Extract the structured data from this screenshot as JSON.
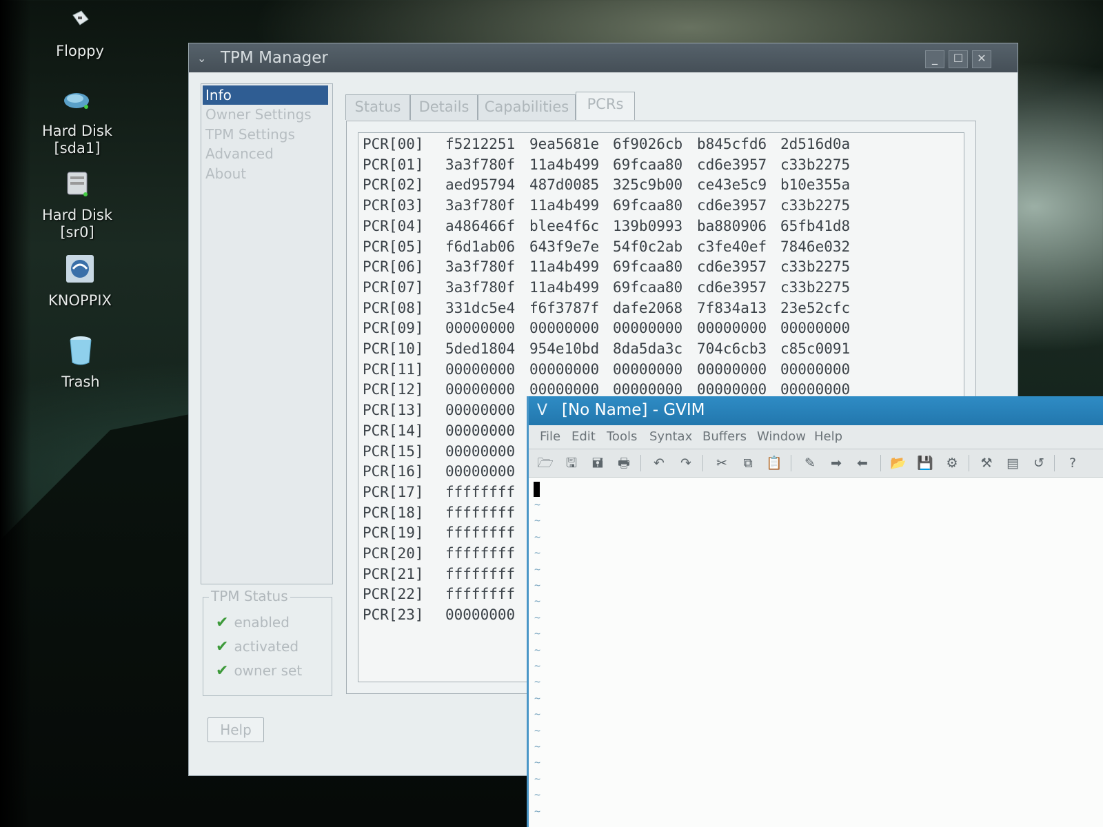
{
  "desktop": {
    "icons": [
      {
        "label": "Floppy",
        "icon": "floppy-icon"
      },
      {
        "label": "Hard Disk\n[sda1]",
        "icon": "hard-disk-icon"
      },
      {
        "label": "Hard Disk\n[sr0]",
        "icon": "cdrom-icon"
      },
      {
        "label": "KNOPPIX",
        "icon": "knoppix-icon"
      },
      {
        "label": "Trash",
        "icon": "trash-icon"
      }
    ]
  },
  "tpm": {
    "title": "TPM Manager",
    "window_buttons": {
      "minimize": "_",
      "maximize": "☐",
      "close": "✕"
    },
    "sidebar": [
      "Info",
      "Owner Settings",
      "TPM Settings",
      "Advanced",
      "About"
    ],
    "selected_sidebar": "Info",
    "status_group": {
      "title": "TPM Status",
      "items": [
        "enabled",
        "activated",
        "owner set"
      ]
    },
    "help_button": "Help",
    "tabs": [
      "Status",
      "Details",
      "Capabilities",
      "PCRs"
    ],
    "active_tab": "PCRs",
    "pcrs": [
      {
        "name": "PCR[00]",
        "values": [
          "f5212251",
          "9ea5681e",
          "6f9026cb",
          "b845cfd6",
          "2d516d0a"
        ]
      },
      {
        "name": "PCR[01]",
        "values": [
          "3a3f780f",
          "11a4b499",
          "69fcaa80",
          "cd6e3957",
          "c33b2275"
        ]
      },
      {
        "name": "PCR[02]",
        "values": [
          "aed95794",
          "487d0085",
          "325c9b00",
          "ce43e5c9",
          "b10e355a"
        ]
      },
      {
        "name": "PCR[03]",
        "values": [
          "3a3f780f",
          "11a4b499",
          "69fcaa80",
          "cd6e3957",
          "c33b2275"
        ]
      },
      {
        "name": "PCR[04]",
        "values": [
          "a486466f",
          "blee4f6c",
          "139b0993",
          "ba880906",
          "65fb41d8"
        ]
      },
      {
        "name": "PCR[05]",
        "values": [
          "f6d1ab06",
          "643f9e7e",
          "54f0c2ab",
          "c3fe40ef",
          "7846e032"
        ]
      },
      {
        "name": "PCR[06]",
        "values": [
          "3a3f780f",
          "11a4b499",
          "69fcaa80",
          "cd6e3957",
          "c33b2275"
        ]
      },
      {
        "name": "PCR[07]",
        "values": [
          "3a3f780f",
          "11a4b499",
          "69fcaa80",
          "cd6e3957",
          "c33b2275"
        ]
      },
      {
        "name": "PCR[08]",
        "values": [
          "331dc5e4",
          "f6f3787f",
          "dafe2068",
          "7f834a13",
          "23e52cfc"
        ]
      },
      {
        "name": "PCR[09]",
        "values": [
          "00000000",
          "00000000",
          "00000000",
          "00000000",
          "00000000"
        ]
      },
      {
        "name": "PCR[10]",
        "values": [
          "5ded1804",
          "954e10bd",
          "8da5da3c",
          "704c6cb3",
          "c85c0091"
        ]
      },
      {
        "name": "PCR[11]",
        "values": [
          "00000000",
          "00000000",
          "00000000",
          "00000000",
          "00000000"
        ]
      },
      {
        "name": "PCR[12]",
        "values": [
          "00000000",
          "00000000",
          "00000000",
          "00000000",
          "00000000"
        ]
      },
      {
        "name": "PCR[13]",
        "values": [
          "00000000"
        ]
      },
      {
        "name": "PCR[14]",
        "values": [
          "00000000"
        ]
      },
      {
        "name": "PCR[15]",
        "values": [
          "00000000"
        ]
      },
      {
        "name": "PCR[16]",
        "values": [
          "00000000"
        ]
      },
      {
        "name": "PCR[17]",
        "values": [
          "ffffffff"
        ]
      },
      {
        "name": "PCR[18]",
        "values": [
          "ffffffff"
        ]
      },
      {
        "name": "PCR[19]",
        "values": [
          "ffffffff"
        ]
      },
      {
        "name": "PCR[20]",
        "values": [
          "ffffffff"
        ]
      },
      {
        "name": "PCR[21]",
        "values": [
          "ffffffff"
        ]
      },
      {
        "name": "PCR[22]",
        "values": [
          "ffffffff"
        ]
      },
      {
        "name": "PCR[23]",
        "values": [
          "00000000"
        ]
      }
    ]
  },
  "gvim": {
    "title": "[No Name] - GVIM",
    "menus": [
      "File",
      "Edit",
      "Tools",
      "Syntax",
      "Buffers",
      "Window",
      "Help"
    ],
    "toolbar": [
      "open-icon",
      "save-icon",
      "save-all-icon",
      "print-icon",
      "undo-icon",
      "redo-icon",
      "cut-icon",
      "copy-icon",
      "paste-icon",
      "replace-icon",
      "find-next-icon",
      "find-prev-icon",
      "load-session-icon",
      "save-session-icon",
      "run-script-icon",
      "make-icon",
      "shell-icon",
      "ctags-icon",
      "help-icon"
    ],
    "tilde_char": "~"
  },
  "colors": {
    "selection": "#2f5d93",
    "gvim_title": "#2f8cc5",
    "check": "#3d9a3a"
  }
}
